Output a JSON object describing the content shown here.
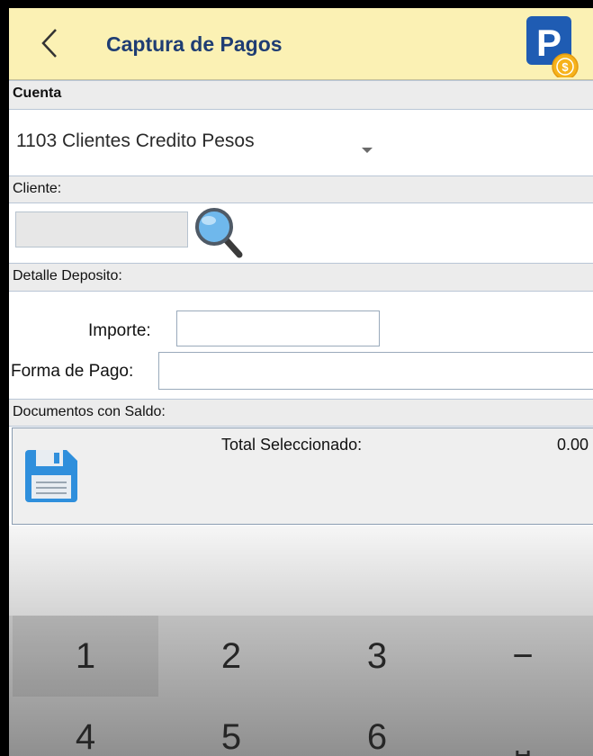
{
  "header": {
    "back_icon": "chevron-left-icon",
    "title": "Captura de Pagos",
    "logo_icon": "parking-payment-logo-icon",
    "logo_letter": "P",
    "accent": "#1f5cb3",
    "bg": "#fbf1b4"
  },
  "cuenta": {
    "section_label": "Cuenta",
    "selected_value": "1103 Clientes Credito Pesos"
  },
  "cliente": {
    "section_label": "Cliente:",
    "value": "",
    "search_icon": "magnifier-icon"
  },
  "detalle": {
    "section_label": "Detalle Deposito:",
    "importe_label": "Importe:",
    "importe_value": "",
    "forma_label": "Forma de Pago:",
    "forma_value": ""
  },
  "documentos": {
    "section_label": "Documentos con Saldo:",
    "save_icon": "floppy-disk-icon",
    "total_label": "Total Seleccionado:",
    "total_value": "0.00"
  },
  "keyboard": {
    "keys": [
      "1",
      "2",
      "3",
      "−",
      "4",
      "5",
      "6",
      "⎵"
    ]
  }
}
